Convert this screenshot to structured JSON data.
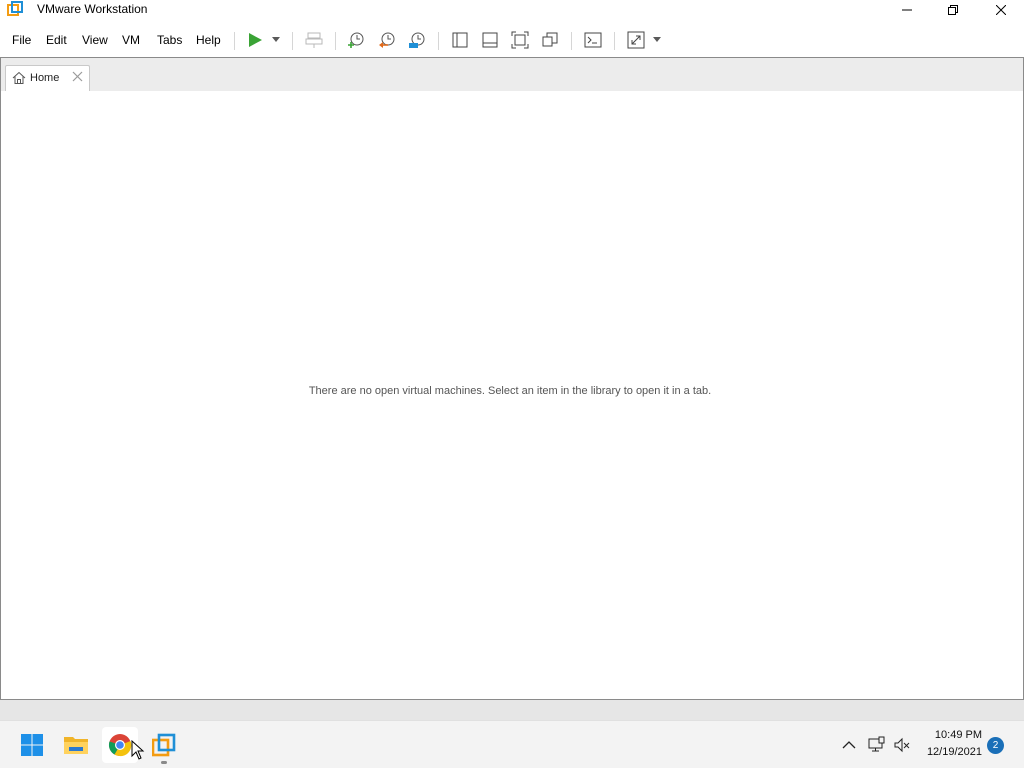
{
  "window": {
    "title": "VMware Workstation",
    "icon": "vmware-app-icon",
    "caption_buttons": [
      "minimize-icon",
      "restore-icon",
      "close-icon"
    ]
  },
  "menu": {
    "items": [
      "File",
      "Edit",
      "View",
      "VM",
      "Tabs",
      "Help"
    ]
  },
  "toolbar": {
    "buttons": [
      "power-on-icon",
      "send-ctrl-alt-del-icon",
      "take-snapshot-icon",
      "revert-snapshot-icon",
      "snapshot-manager-icon",
      "show-library-icon",
      "show-thumbnail-bar-icon",
      "full-screen-icon",
      "unity-icon",
      "console-view-icon",
      "stretch-guest-icon"
    ],
    "accent": "#3aa335"
  },
  "tabs": [
    {
      "label": "Home",
      "icon": "home-icon",
      "closable": true
    }
  ],
  "main": {
    "empty_message": "There are no open virtual machines. Select an item in the library to open it in a tab."
  },
  "taskbar": {
    "apps": [
      "windows-start-icon",
      "file-explorer-icon",
      "chrome-icon",
      "vmware-taskbar-icon"
    ],
    "tray": {
      "icons": [
        "chevron-up-icon",
        "network-icon",
        "volume-muted-icon"
      ],
      "time": "10:49 PM",
      "date": "12/19/2021",
      "notification_count": "2"
    }
  }
}
